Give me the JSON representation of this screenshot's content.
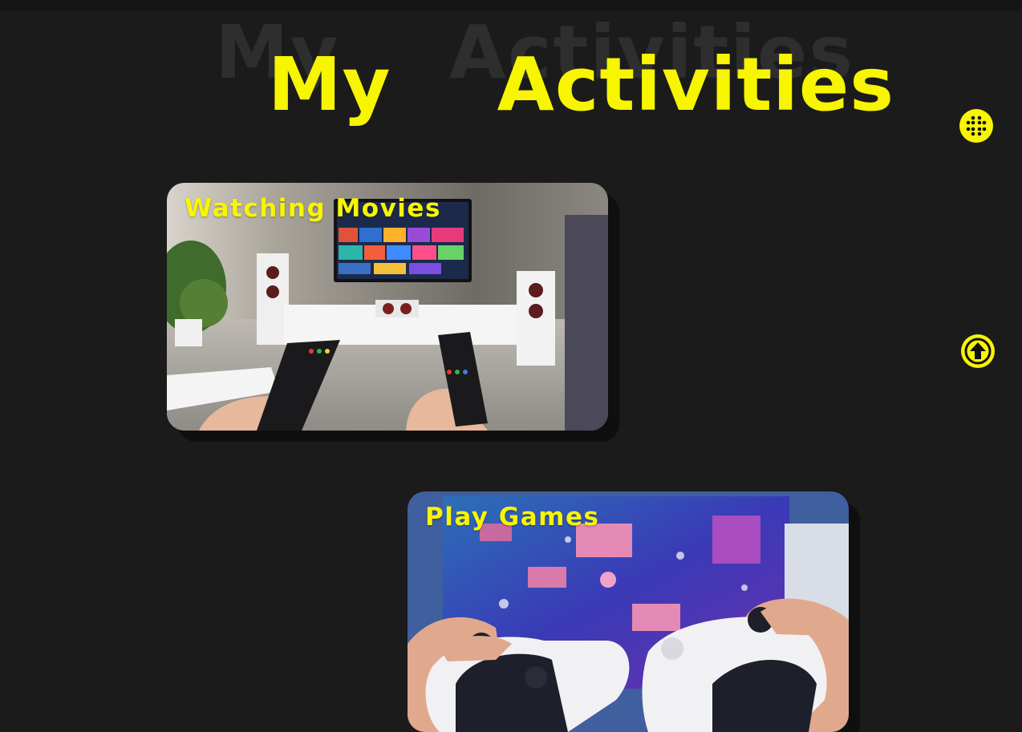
{
  "header": {
    "title_shadow": "My    Activities",
    "title": "My    Activities"
  },
  "fabs": {
    "menu_icon": "grid-dots-icon",
    "scroll_top_icon": "arrow-up-icon"
  },
  "activities": [
    {
      "label": "Watching Movies",
      "image": "living-room-tv-remotes"
    },
    {
      "label": "Play Games",
      "image": "gamepads-in-front-of-tv"
    }
  ],
  "colors": {
    "accent": "#f7f500",
    "background": "#1b1b1b",
    "shadow_text": "#2e2e2e"
  }
}
